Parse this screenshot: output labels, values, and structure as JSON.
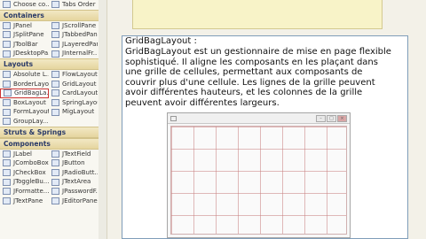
{
  "palette": {
    "sections": [
      {
        "title": null,
        "rows": [
          [
            "Choose co...",
            "Tabs Order"
          ]
        ]
      },
      {
        "title": "Containers",
        "rows": [
          [
            "JPanel",
            "JScrollPane"
          ],
          [
            "JSplitPane",
            "JTabbedPane"
          ],
          [
            "JToolBar",
            "JLayeredPane"
          ],
          [
            "JDesktopPa...",
            "JInternalFr..."
          ]
        ]
      },
      {
        "title": "Layouts",
        "rows": [
          [
            "Absolute L...",
            "FlowLayout"
          ],
          [
            "BorderLayout",
            "GridLayout"
          ],
          [
            "GridBagLa...",
            "CardLayout"
          ],
          [
            "BoxLayout",
            "SpringLayout"
          ],
          [
            "FormLayout",
            "MigLayout"
          ],
          [
            "GroupLay...",
            ""
          ]
        ]
      },
      {
        "title": "Struts & Springs",
        "rows": []
      },
      {
        "title": "Components",
        "rows": [
          [
            "JLabel",
            "JTextField"
          ],
          [
            "JComboBox",
            "JButton"
          ],
          [
            "JCheckBox",
            "JRadioButt..."
          ],
          [
            "JToggleBu...",
            "JTextArea"
          ],
          [
            "JFormatte...",
            "JPasswordF..."
          ],
          [
            "JTextPane",
            "JEditorPane"
          ]
        ]
      }
    ],
    "selected": "GridBagLa..."
  },
  "tooltip": {
    "title": "GridBagLayout :",
    "description": "GridBagLayout est un gestionnaire de mise en page flexible sophistiqué. Il aligne les composants en les plaçant dans une grille de cellules, permettant aux composants de couvrir plus d'une cellule. Les lignes de la grille peuvent avoir différentes hauteurs, et les colonnes de la grille peuvent avoir différentes largeurs."
  },
  "preview": {
    "icons": [
      "app-icon",
      "minimize-icon",
      "maximize-icon",
      "close-icon"
    ],
    "grid_color": "#c88282"
  }
}
